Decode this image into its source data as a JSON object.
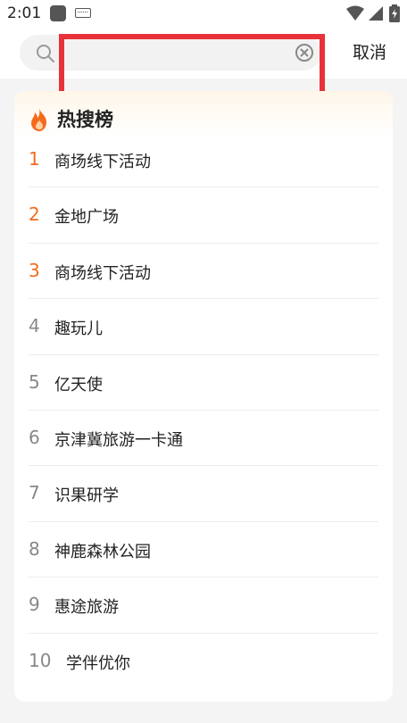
{
  "status_bar": {
    "time": "2:01",
    "icons": [
      "app-icon",
      "keyboard-icon",
      "wifi-icon",
      "signal-icon",
      "battery-icon"
    ]
  },
  "search": {
    "value": "",
    "placeholder": "",
    "cancel_label": "取消"
  },
  "hot_list": {
    "title": "热搜榜",
    "items": [
      {
        "rank": "1",
        "label": "商场线下活动"
      },
      {
        "rank": "2",
        "label": "金地广场"
      },
      {
        "rank": "3",
        "label": "商场线下活动"
      },
      {
        "rank": "4",
        "label": "趣玩儿"
      },
      {
        "rank": "5",
        "label": "亿天使"
      },
      {
        "rank": "6",
        "label": "京津冀旅游一卡通"
      },
      {
        "rank": "7",
        "label": "识果研学"
      },
      {
        "rank": "8",
        "label": "神鹿森林公园"
      },
      {
        "rank": "9",
        "label": "惠途旅游"
      },
      {
        "rank": "10",
        "label": "学伴优你"
      }
    ]
  },
  "colors": {
    "accent_rank": "#f26b1d",
    "annotation": "#e8323a",
    "normal_rank": "#888888"
  }
}
